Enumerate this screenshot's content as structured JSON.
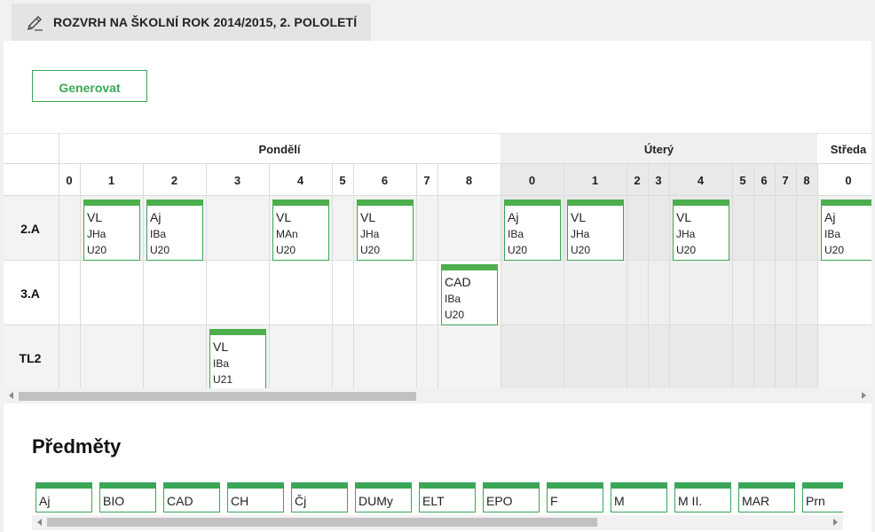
{
  "header": {
    "title": "ROZVRH NA ŠKOLNÍ ROK 2014/2015, 2. POLOLETÍ",
    "icon": "pencil-icon"
  },
  "toolbar": {
    "generate_label": "Generovat"
  },
  "colors": {
    "accent": "#3aa658",
    "card_bar": "#4cae4c",
    "weekday_odd_bg": "#ffffff",
    "weekday_even_bg": "#efefef"
  },
  "timetable": {
    "days": [
      {
        "name": "Pondělí",
        "periods": [
          "0",
          "1",
          "2",
          "3",
          "4",
          "5",
          "6",
          "7",
          "8"
        ]
      },
      {
        "name": "Úterý",
        "periods": [
          "0",
          "1",
          "2",
          "3",
          "4",
          "5",
          "6",
          "7",
          "8"
        ]
      },
      {
        "name": "Středa",
        "periods": [
          "0"
        ]
      }
    ],
    "classes": [
      "2.A",
      "3.A",
      "TL2"
    ],
    "lessons": [
      {
        "class": "2.A",
        "day": 0,
        "period": "1",
        "subject": "VL",
        "teacher": "JHa",
        "room": "U20"
      },
      {
        "class": "2.A",
        "day": 0,
        "period": "2",
        "subject": "Aj",
        "teacher": "IBa",
        "room": "U20"
      },
      {
        "class": "2.A",
        "day": 0,
        "period": "4",
        "subject": "VL",
        "teacher": "MAn",
        "room": "U20"
      },
      {
        "class": "2.A",
        "day": 0,
        "period": "6",
        "subject": "VL",
        "teacher": "JHa",
        "room": "U20"
      },
      {
        "class": "2.A",
        "day": 1,
        "period": "0",
        "subject": "Aj",
        "teacher": "IBa",
        "room": "U20"
      },
      {
        "class": "2.A",
        "day": 1,
        "period": "1",
        "subject": "VL",
        "teacher": "JHa",
        "room": "U20"
      },
      {
        "class": "2.A",
        "day": 1,
        "period": "4",
        "subject": "VL",
        "teacher": "JHa",
        "room": "U20"
      },
      {
        "class": "2.A",
        "day": 2,
        "period": "0",
        "subject": "Aj",
        "teacher": "IBa",
        "room": "U20"
      },
      {
        "class": "3.A",
        "day": 0,
        "period": "8",
        "subject": "CAD",
        "teacher": "IBa",
        "room": "U20"
      },
      {
        "class": "TL2",
        "day": 0,
        "period": "3",
        "subject": "VL",
        "teacher": "IBa",
        "room": "U21"
      }
    ]
  },
  "subjects": {
    "title": "Předměty",
    "items": [
      "Aj",
      "BIO",
      "CAD",
      "CH",
      "Čj",
      "DUMy",
      "ELT",
      "EPO",
      "F",
      "M",
      "M II.",
      "MAR",
      "Prn"
    ]
  }
}
